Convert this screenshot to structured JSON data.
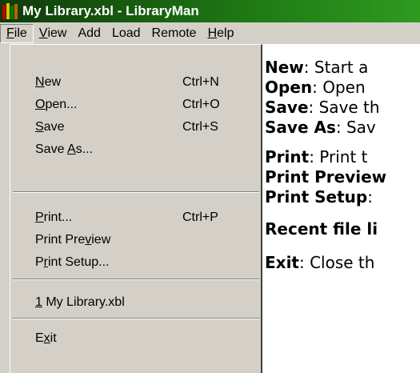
{
  "window": {
    "title": "My Library.xbl - LibraryMan",
    "icon": "bookshelf-icon"
  },
  "menubar": {
    "items": [
      {
        "label": "File",
        "mnemonic": "F",
        "rest": "ile"
      },
      {
        "label": "View",
        "mnemonic": "V",
        "rest": "iew"
      },
      {
        "label": "Add"
      },
      {
        "label": "Load"
      },
      {
        "label": "Remote"
      },
      {
        "label": "Help",
        "mnemonic": "H",
        "rest": "elp"
      }
    ]
  },
  "file_menu": {
    "items": [
      {
        "pre": "",
        "mn": "N",
        "post": "ew",
        "shortcut": "Ctrl+N"
      },
      {
        "pre": "",
        "mn": "O",
        "post": "pen...",
        "shortcut": "Ctrl+O"
      },
      {
        "pre": "",
        "mn": "S",
        "post": "ave",
        "shortcut": "Ctrl+S"
      },
      {
        "pre": "Save ",
        "mn": "A",
        "post": "s...",
        "shortcut": ""
      },
      {
        "pre": "",
        "mn": "P",
        "post": "rint...",
        "shortcut": "Ctrl+P"
      },
      {
        "pre": "Print Pre",
        "mn": "v",
        "post": "iew",
        "shortcut": ""
      },
      {
        "pre": "P",
        "mn": "r",
        "post": "int Setup...",
        "shortcut": ""
      },
      {
        "pre": "",
        "mn": "1",
        "post": " My Library.xbl",
        "shortcut": ""
      },
      {
        "pre": "E",
        "mn": "x",
        "post": "it",
        "shortcut": ""
      }
    ]
  },
  "descriptions": [
    {
      "term": "New",
      "text": ":  Start a"
    },
    {
      "term": "Open",
      "text": ":  Open"
    },
    {
      "term": "Save",
      "text": ":  Save th"
    },
    {
      "term": "Save As",
      "text": ":  Sav"
    },
    {
      "term": "Print",
      "text": ":  Print t"
    },
    {
      "term": "Print Preview",
      "text": ""
    },
    {
      "term": "Print Setup",
      "text": ":"
    },
    {
      "term": "Recent file li",
      "text": ""
    },
    {
      "term": "Exit",
      "text": ":  Close th"
    }
  ]
}
